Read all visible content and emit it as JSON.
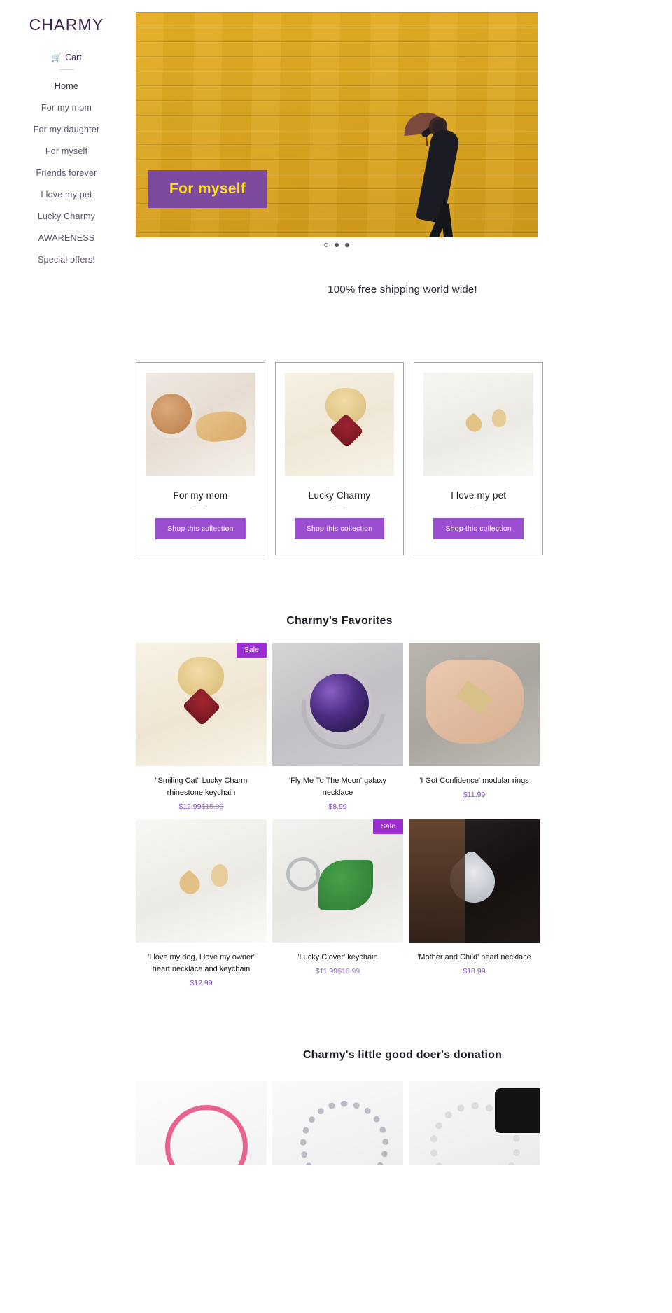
{
  "brand": "CHARMY",
  "sidebar": {
    "cart_label": "Cart",
    "cart_icon": "shopping-cart-icon",
    "items": [
      {
        "label": "Home"
      },
      {
        "label": "For my mom"
      },
      {
        "label": "For my daughter"
      },
      {
        "label": "For myself"
      },
      {
        "label": "Friends forever"
      },
      {
        "label": "I love my pet"
      },
      {
        "label": "Lucky Charmy"
      },
      {
        "label": "AWARENESS"
      },
      {
        "label": "Special offers!"
      }
    ]
  },
  "hero": {
    "badge_label": "For myself",
    "slide_count": 3,
    "active_slide": 1
  },
  "shipping_banner": "100% free shipping world wide!",
  "collections": {
    "cards": [
      {
        "title": "For my mom",
        "button": "Shop this collection",
        "image": "mama-bear-necklace"
      },
      {
        "title": "Lucky Charmy",
        "button": "Shop this collection",
        "image": "rhinestone-cat-keychain"
      },
      {
        "title": "I love my pet",
        "button": "Shop this collection",
        "image": "pet-heart-necklace"
      }
    ]
  },
  "favorites": {
    "heading": "Charmy's Favorites",
    "sale_badge": "Sale",
    "products": [
      {
        "name": "\"Smiling Cat\" Lucky Charm rhinestone keychain",
        "price": "$12.99",
        "compare_at": "$15.99",
        "on_sale": true,
        "image": "smiling-cat-keychain"
      },
      {
        "name": "'Fly Me To The Moon' galaxy necklace",
        "price": "$8.99",
        "compare_at": "",
        "on_sale": false,
        "image": "galaxy-moon-necklace"
      },
      {
        "name": "'I Got Confidence' modular rings",
        "price": "$11.99",
        "compare_at": "",
        "on_sale": false,
        "image": "modular-rings"
      },
      {
        "name": "'I love my dog, I love my owner' heart necklace and keychain",
        "price": "$12.99",
        "compare_at": "",
        "on_sale": false,
        "image": "dog-owner-heart-necklace"
      },
      {
        "name": "'Lucky Clover' keychain",
        "price": "$11.99",
        "compare_at": "$16.99",
        "on_sale": true,
        "image": "lucky-clover-keychain"
      },
      {
        "name": "'Mother and Child' heart necklace",
        "price": "$18.99",
        "compare_at": "",
        "on_sale": false,
        "image": "mother-child-heart-necklace"
      }
    ]
  },
  "donation": {
    "heading": "Charmy's little good doer's donation",
    "items": [
      {
        "image": "pink-ribbon-bracelet"
      },
      {
        "image": "silver-chain-bracelet"
      },
      {
        "image": "white-bead-bracelet"
      }
    ]
  },
  "colors": {
    "brand_purple": "#3d2452",
    "accent_purple": "#9b4ed0",
    "sale_purple": "#9b2ed0",
    "price_purple": "#7b4fa8",
    "hero_yellow": "#dfa92a",
    "hero_badge_text": "#ffe11a"
  }
}
